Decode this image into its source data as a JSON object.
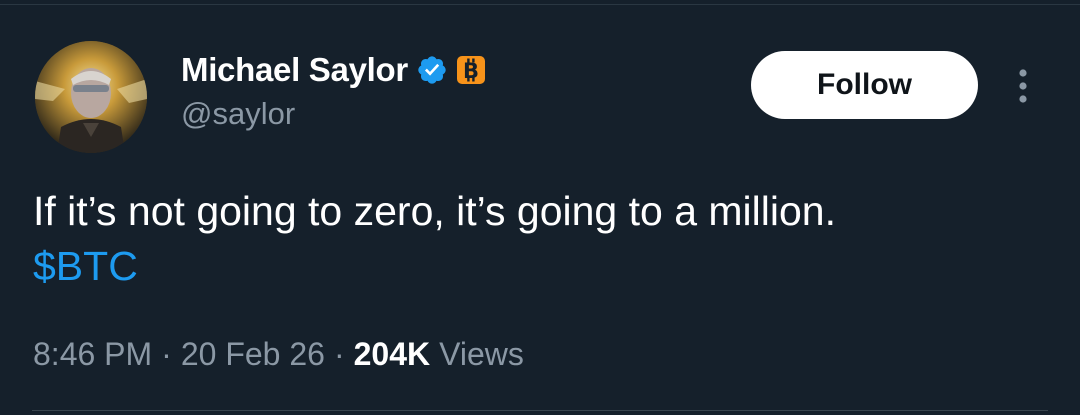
{
  "author": {
    "display_name": "Michael Saylor",
    "handle": "@saylor",
    "verified_icon": "verified-badge-icon",
    "affiliate_icon": "bitcoin-badge-icon"
  },
  "actions": {
    "follow_label": "Follow",
    "more_icon": "more-vertical-icon"
  },
  "tweet": {
    "text": "If it’s not going to zero, it’s going to a million.",
    "cashtag": "$BTC"
  },
  "meta": {
    "time": "8:46 PM",
    "separator": "·",
    "date": "20 Feb 26",
    "views_count": "204K",
    "views_label": "Views"
  },
  "colors": {
    "background": "#15202b",
    "link": "#1d9bf0",
    "secondary_text": "#8b98a5",
    "verified": "#1d9bf0",
    "bitcoin_orange": "#f7931a"
  }
}
